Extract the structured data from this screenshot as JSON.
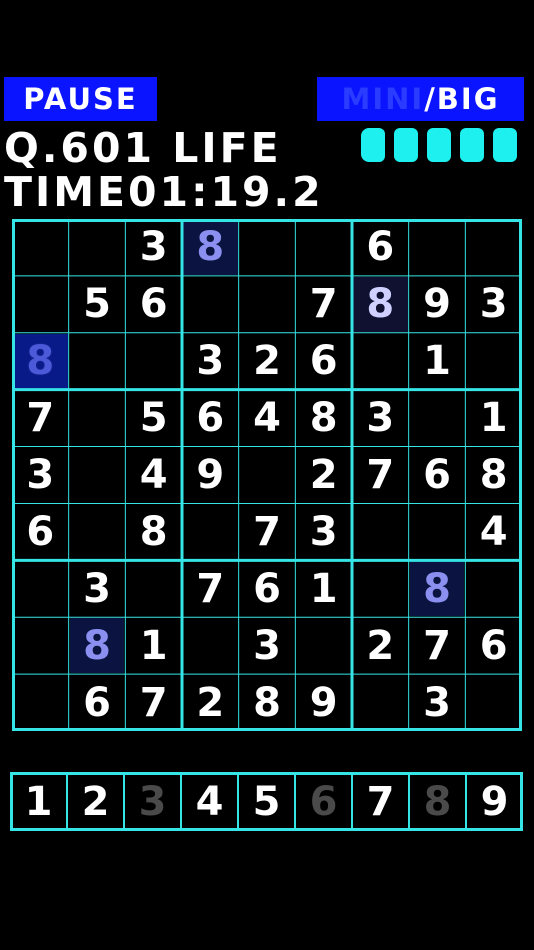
{
  "header": {
    "pause_label": "PAUSE",
    "mini_label": "MINI",
    "big_label": "/BIG",
    "question_label": "Q.601",
    "life_label": "LIFE",
    "life_count": 5,
    "time_label": "TIME",
    "time_value": "01:19.2"
  },
  "colors": {
    "grid": "#35e5e5",
    "accent": "#0a14ff",
    "life": "#1ef0f0"
  },
  "board": [
    [
      "",
      "",
      "3",
      "8",
      "",
      "",
      "6",
      "",
      ""
    ],
    [
      "",
      "5",
      "6",
      "",
      "",
      "7",
      "8",
      "9",
      "3"
    ],
    [
      "8",
      "",
      "",
      "3",
      "2",
      "6",
      "",
      "1",
      ""
    ],
    [
      "7",
      "",
      "5",
      "6",
      "4",
      "8",
      "3",
      "",
      "1"
    ],
    [
      "3",
      "",
      "4",
      "9",
      "",
      "2",
      "7",
      "6",
      "8"
    ],
    [
      "6",
      "",
      "8",
      "",
      "7",
      "3",
      "",
      "",
      "4"
    ],
    [
      "",
      "3",
      "",
      "7",
      "6",
      "1",
      "",
      "8",
      ""
    ],
    [
      "",
      "8",
      "1",
      "",
      "3",
      "",
      "2",
      "7",
      "6"
    ],
    [
      "",
      "6",
      "7",
      "2",
      "8",
      "9",
      "",
      "3",
      ""
    ]
  ],
  "highlighted_cells": [
    {
      "r": 0,
      "c": 3,
      "style": "hl"
    },
    {
      "r": 1,
      "c": 6,
      "style": "hl2"
    },
    {
      "r": 2,
      "c": 0,
      "style": "hl3"
    },
    {
      "r": 6,
      "c": 7,
      "style": "hl"
    },
    {
      "r": 7,
      "c": 1,
      "style": "hl"
    }
  ],
  "number_pad": [
    {
      "label": "1",
      "dim": false
    },
    {
      "label": "2",
      "dim": false
    },
    {
      "label": "3",
      "dim": true
    },
    {
      "label": "4",
      "dim": false
    },
    {
      "label": "5",
      "dim": false
    },
    {
      "label": "6",
      "dim": true
    },
    {
      "label": "7",
      "dim": false
    },
    {
      "label": "8",
      "dim": true
    },
    {
      "label": "9",
      "dim": false
    }
  ]
}
